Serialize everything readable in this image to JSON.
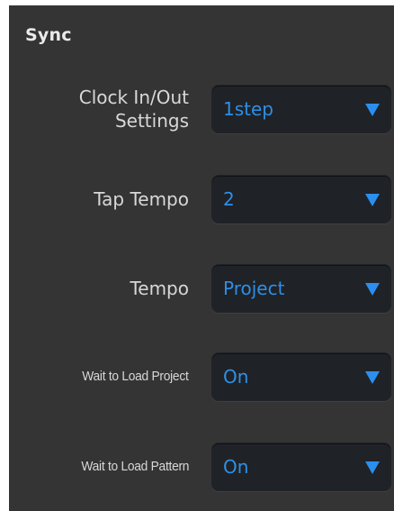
{
  "section": {
    "title": "Sync"
  },
  "settings": [
    {
      "label": "Clock In/Out\nSettings",
      "value": "1step"
    },
    {
      "label": "Tap Tempo",
      "value": "2"
    },
    {
      "label": "Tempo",
      "value": "Project"
    },
    {
      "label": "Wait to Load Project",
      "value": "On"
    },
    {
      "label": "Wait to Load Pattern",
      "value": "On"
    }
  ],
  "colors": {
    "panel_bg": "#343434",
    "dropdown_bg": "#1f2227",
    "accent": "#2b8ff0",
    "label_text": "#d8d8d8"
  },
  "icons": {
    "dropdown": "chevron-down-icon"
  }
}
